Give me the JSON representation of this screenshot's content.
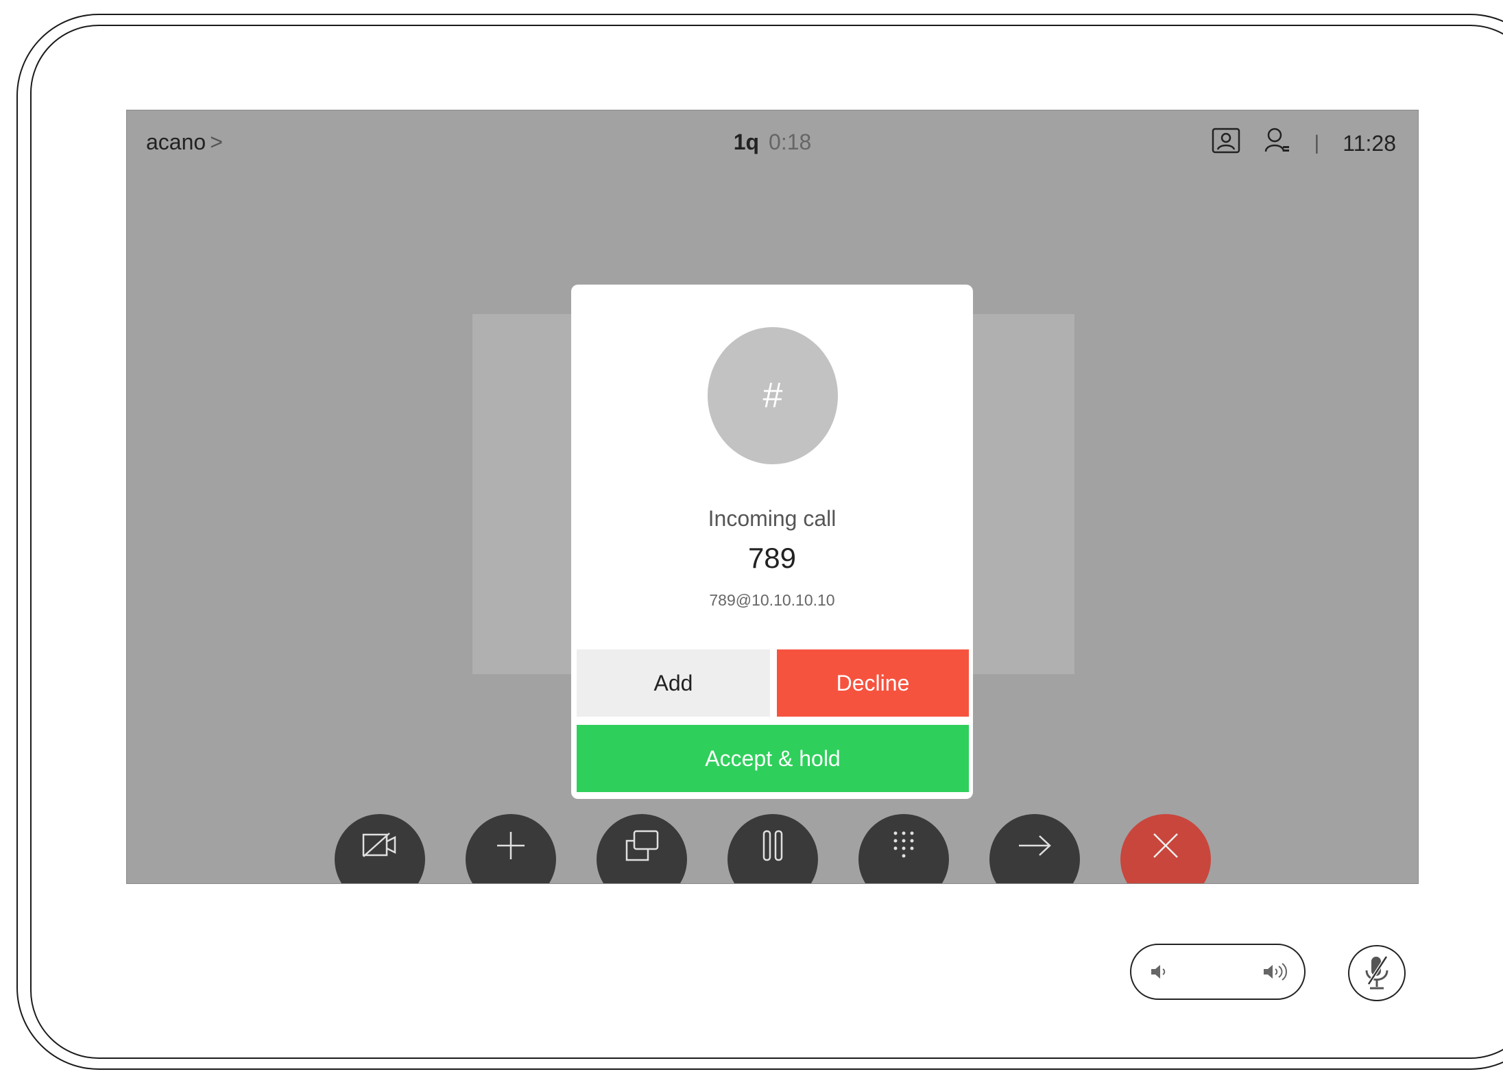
{
  "topbar": {
    "room_name": "acano",
    "room_chevron": ">",
    "call_count": "1q",
    "call_timer": "0:18",
    "separator": "|",
    "clock": "11:28"
  },
  "dialog": {
    "avatar_symbol": "#",
    "title": "Incoming call",
    "number": "789",
    "address": "789@10.10.10.10",
    "add_label": "Add",
    "decline_label": "Decline",
    "accept_label": "Accept & hold"
  },
  "controls": [
    {
      "icon": "camera-off-icon"
    },
    {
      "icon": "plus-icon"
    },
    {
      "icon": "share-icon"
    },
    {
      "icon": "pause-icon"
    },
    {
      "icon": "keypad-icon"
    },
    {
      "icon": "transfer-icon"
    },
    {
      "icon": "end-call-icon"
    }
  ],
  "colors": {
    "screen_bg": "#a2a2a2",
    "decline": "#f6533f",
    "accept": "#2fcf5b",
    "end_call": "#c9463c",
    "control_bg": "#3a3a3a"
  }
}
